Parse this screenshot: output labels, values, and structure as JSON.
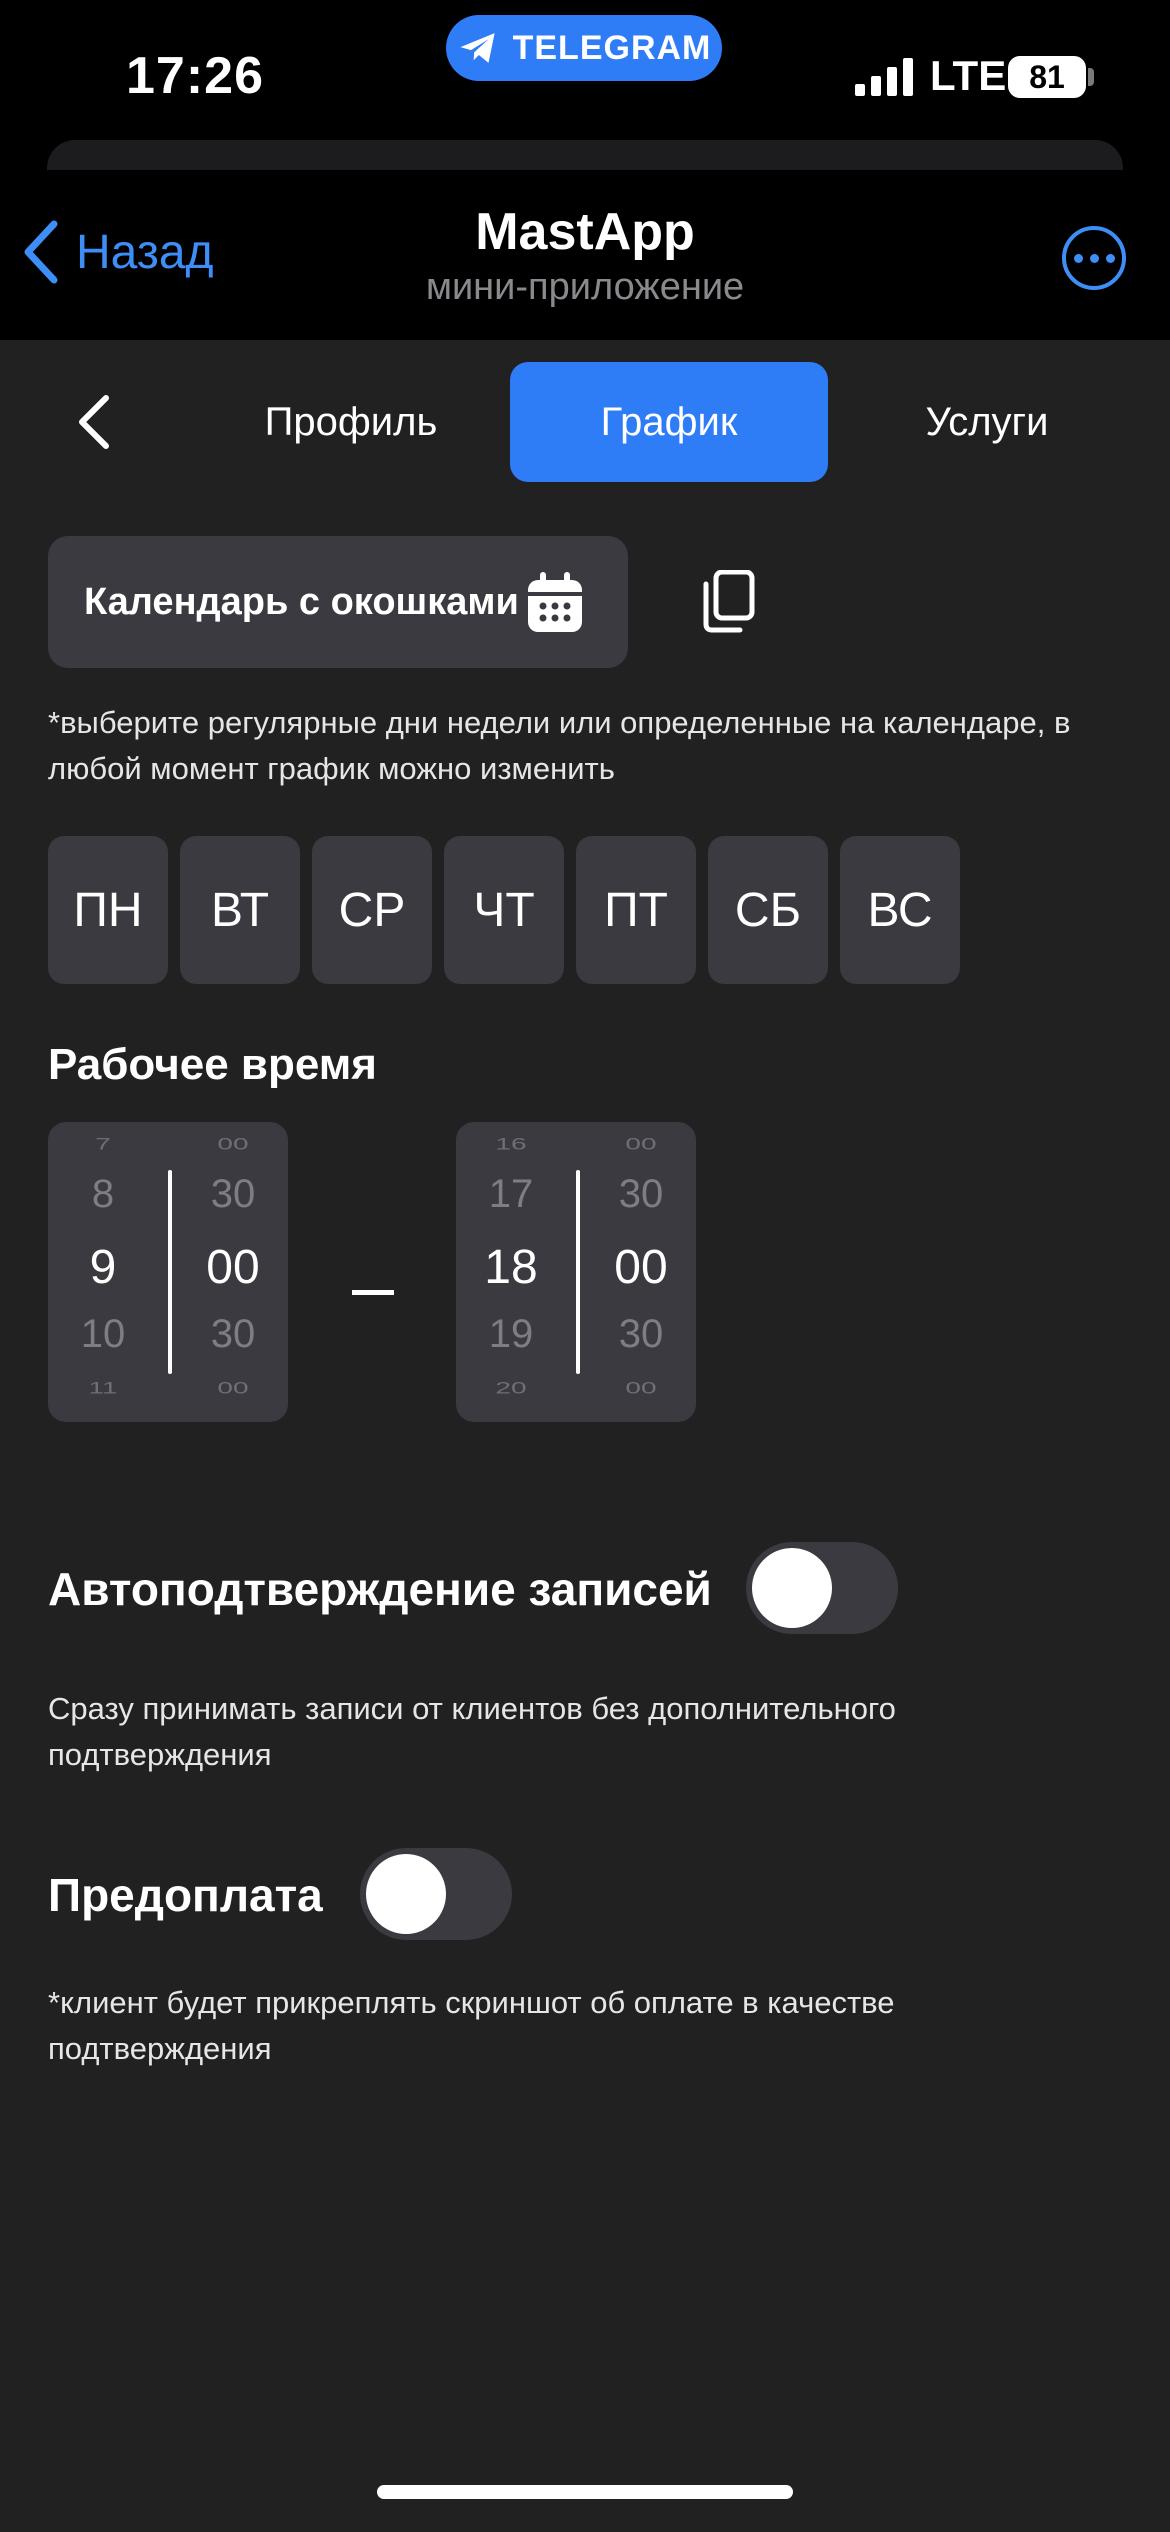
{
  "status_bar": {
    "time": "17:26",
    "app_pill": "TELEGRAM",
    "network": "LTE",
    "battery": "81"
  },
  "header": {
    "back_label": "Назад",
    "title": "MastApp",
    "subtitle": "мини-приложение"
  },
  "tabs": [
    {
      "label": "Профиль",
      "active": false
    },
    {
      "label": "График",
      "active": true
    },
    {
      "label": "Услуги",
      "active": false
    }
  ],
  "schedule": {
    "calendar_button": "Календарь с окошками",
    "hint": "*выберите регулярные дни недели или определенные на календаре, в любой момент график можно изменить",
    "days": [
      "ПН",
      "ВТ",
      "СР",
      "ЧТ",
      "ПТ",
      "СБ",
      "ВС"
    ]
  },
  "work_time": {
    "title": "Рабочее время",
    "start": {
      "hours": [
        "7",
        "8",
        "9",
        "10",
        "11"
      ],
      "minutes": [
        "00",
        "30",
        "00",
        "30",
        "00"
      ]
    },
    "separator": "–",
    "end": {
      "hours": [
        "16",
        "17",
        "18",
        "19",
        "20"
      ],
      "minutes": [
        "00",
        "30",
        "00",
        "30",
        "00"
      ]
    }
  },
  "auto_confirm": {
    "label": "Автоподтверждение записей",
    "enabled": false,
    "description": "Сразу принимать записи от клиентов без дополнительного подтверждения"
  },
  "prepayment": {
    "label": "Предоплата",
    "enabled": false,
    "description": "*клиент будет прикреплять скриншот об оплате в качестве подтверждения"
  },
  "colors": {
    "accent": "#2f7df6",
    "link": "#3e8ef7",
    "background": "#212121",
    "card": "#3a3a40"
  }
}
